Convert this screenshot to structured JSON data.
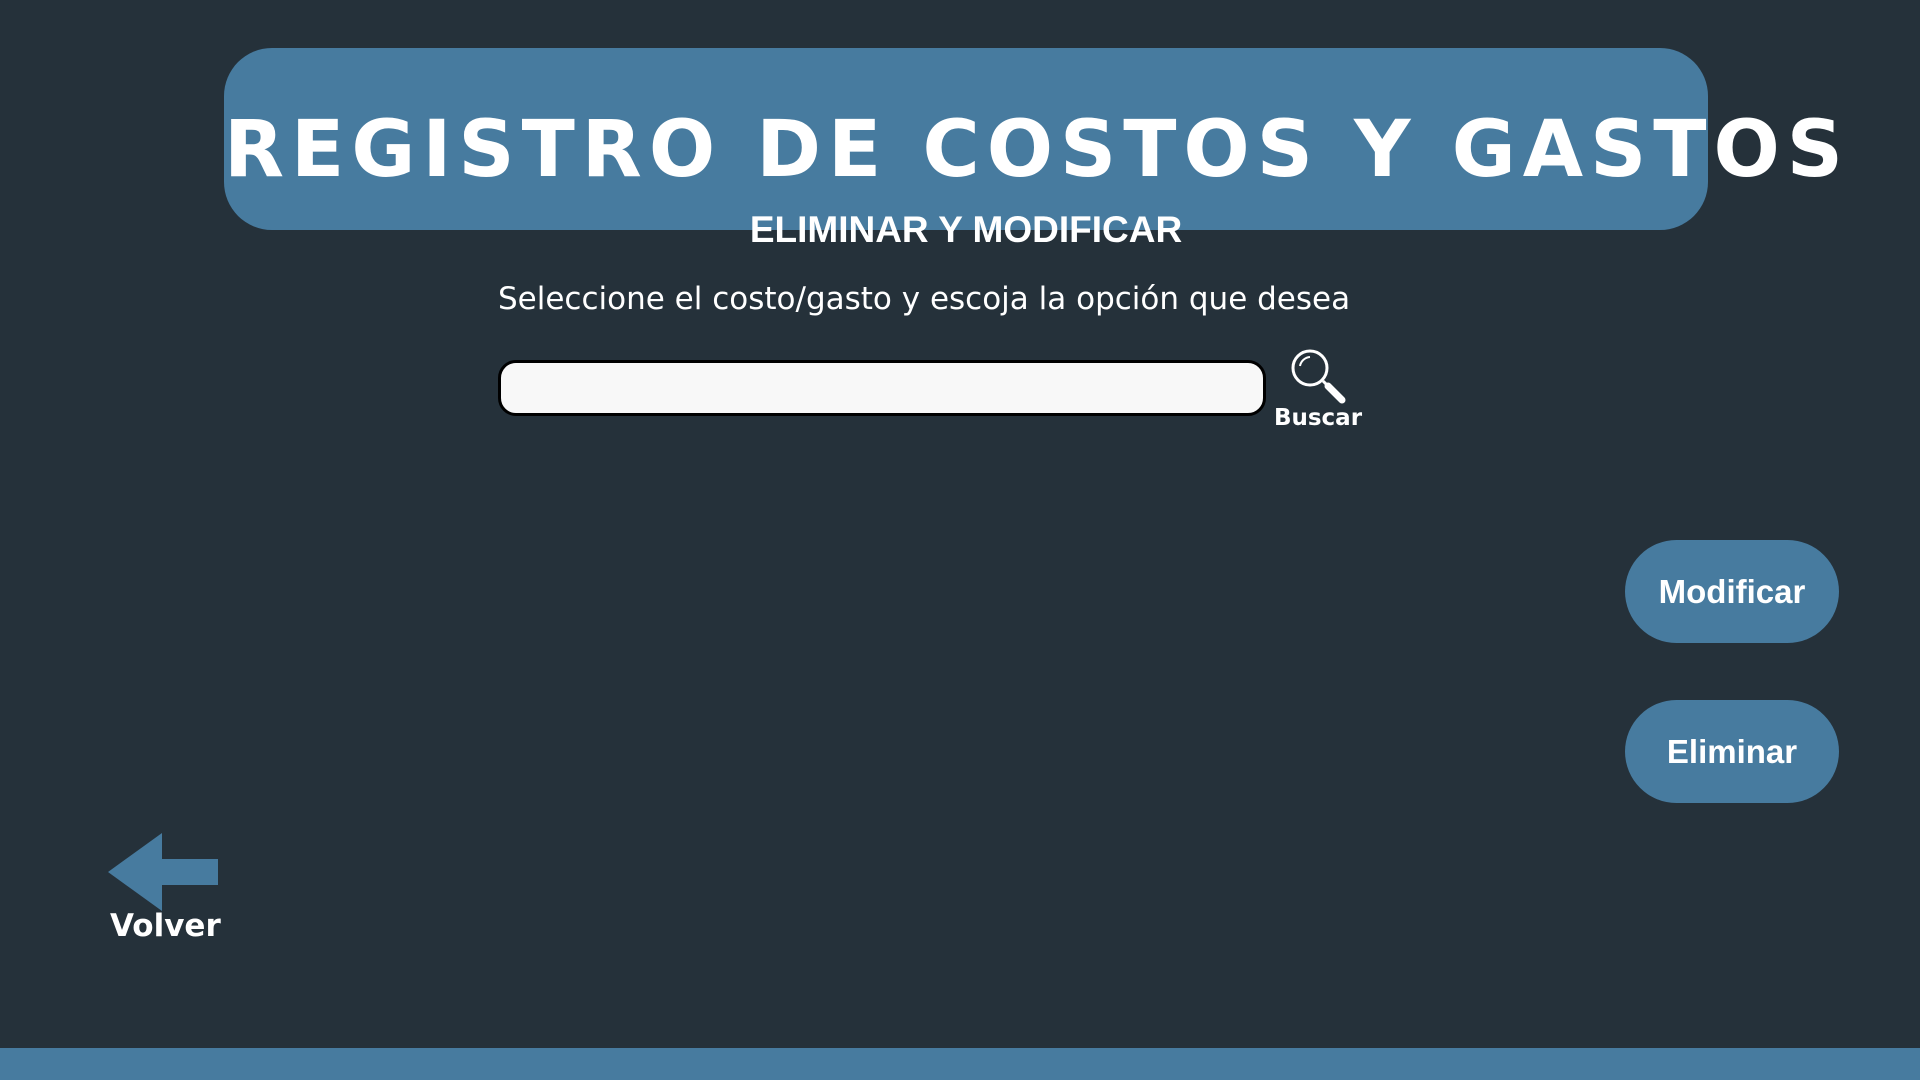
{
  "header": {
    "title": "REGISTRO DE COSTOS Y GASTOS",
    "subtitle": "ELIMINAR Y MODIFICAR"
  },
  "instruction": "Seleccione el costo/gasto y escoja la opción que desea",
  "search": {
    "value": "",
    "placeholder": "",
    "button_label": "Buscar",
    "icon": "search-icon"
  },
  "actions": {
    "modify_label": "Modificar",
    "delete_label": "Eliminar"
  },
  "back": {
    "label": "Volver",
    "icon": "arrow-left-icon"
  },
  "colors": {
    "background": "#25313a",
    "accent": "#477b9f",
    "text": "#ffffff",
    "input_background": "#f8f8f8"
  }
}
